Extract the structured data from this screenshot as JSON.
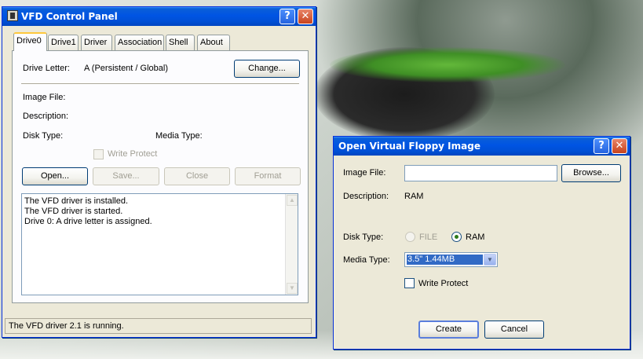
{
  "main_window": {
    "title": "VFD Control Panel",
    "help_glyph": "?",
    "close_glyph": "✕",
    "tabs": [
      {
        "label": "Drive0"
      },
      {
        "label": "Drive1"
      },
      {
        "label": "Driver"
      },
      {
        "label": "Association"
      },
      {
        "label": "Shell"
      },
      {
        "label": "About"
      }
    ],
    "drive_letter_label": "Drive Letter:",
    "drive_letter_value": "A (Persistent / Global)",
    "change_button": "Change...",
    "image_file_label": "Image File:",
    "description_label": "Description:",
    "disk_type_label": "Disk Type:",
    "media_type_label": "Media Type:",
    "write_protect_label": "Write Protect",
    "open_button": "Open...",
    "save_button": "Save...",
    "close_button": "Close",
    "format_button": "Format",
    "log_lines": [
      "The VFD driver is installed.",
      "The VFD driver is started.",
      "Drive 0: A drive letter is assigned."
    ],
    "status_text": "The VFD driver 2.1 is running."
  },
  "dialog": {
    "title": "Open Virtual Floppy Image",
    "help_glyph": "?",
    "close_glyph": "✕",
    "image_file_label": "Image File:",
    "image_file_value": "",
    "browse_button": "Browse...",
    "description_label": "Description:",
    "description_value": "RAM",
    "disk_type_label": "Disk Type:",
    "disk_type_options": [
      "FILE",
      "RAM"
    ],
    "disk_type_selected": "RAM",
    "media_type_label": "Media Type:",
    "media_type_value": "3.5\"  1.44MB",
    "write_protect_label": "Write Protect",
    "create_button": "Create",
    "cancel_button": "Cancel"
  },
  "colors": {
    "titlebar": "#0054e3",
    "window_face": "#ece9d8",
    "selection": "#316ac5"
  }
}
